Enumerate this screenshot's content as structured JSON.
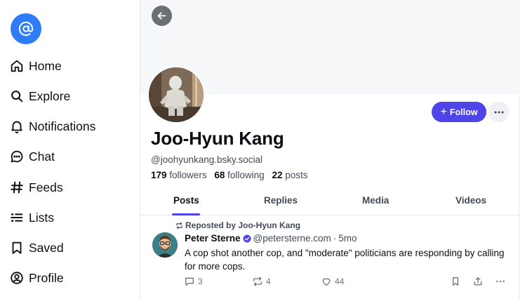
{
  "colors": {
    "accent": "#4f44e8",
    "logo": "#2e7cf6",
    "text_primary": "#0b0f14",
    "text_secondary": "#414b58"
  },
  "sidebar": {
    "logo_icon": "at-sign-icon",
    "items": [
      {
        "label": "Home",
        "icon": "home-icon"
      },
      {
        "label": "Explore",
        "icon": "search-icon"
      },
      {
        "label": "Notifications",
        "icon": "bell-icon"
      },
      {
        "label": "Chat",
        "icon": "chat-bubble-icon"
      },
      {
        "label": "Feeds",
        "icon": "hashtag-icon"
      },
      {
        "label": "Lists",
        "icon": "list-icon"
      },
      {
        "label": "Saved",
        "icon": "bookmark-icon"
      },
      {
        "label": "Profile",
        "icon": "user-circle-icon"
      }
    ]
  },
  "profile": {
    "display_name": "Joo-Hyun Kang",
    "handle": "@joohyunkang.bsky.social",
    "followers_count": "179",
    "followers_label": "followers",
    "following_count": "68",
    "following_label": "following",
    "posts_count": "22",
    "posts_label": "posts",
    "follow_label": "Follow",
    "follow_plus": "+"
  },
  "tabs": [
    {
      "label": "Posts",
      "active": true
    },
    {
      "label": "Replies",
      "active": false
    },
    {
      "label": "Media",
      "active": false
    },
    {
      "label": "Videos",
      "active": false
    }
  ],
  "post": {
    "repost_text": "Reposted by Joo-Hyun Kang",
    "author_name": "Peter Sterne",
    "author_handle": "@petersterne.com",
    "separator": "·",
    "time": "5mo",
    "text": "A cop shot another cop, and \"moderate\" politicians are responding by calling for more cops.",
    "reply_count": "3",
    "repost_count": "4",
    "like_count": "44"
  }
}
